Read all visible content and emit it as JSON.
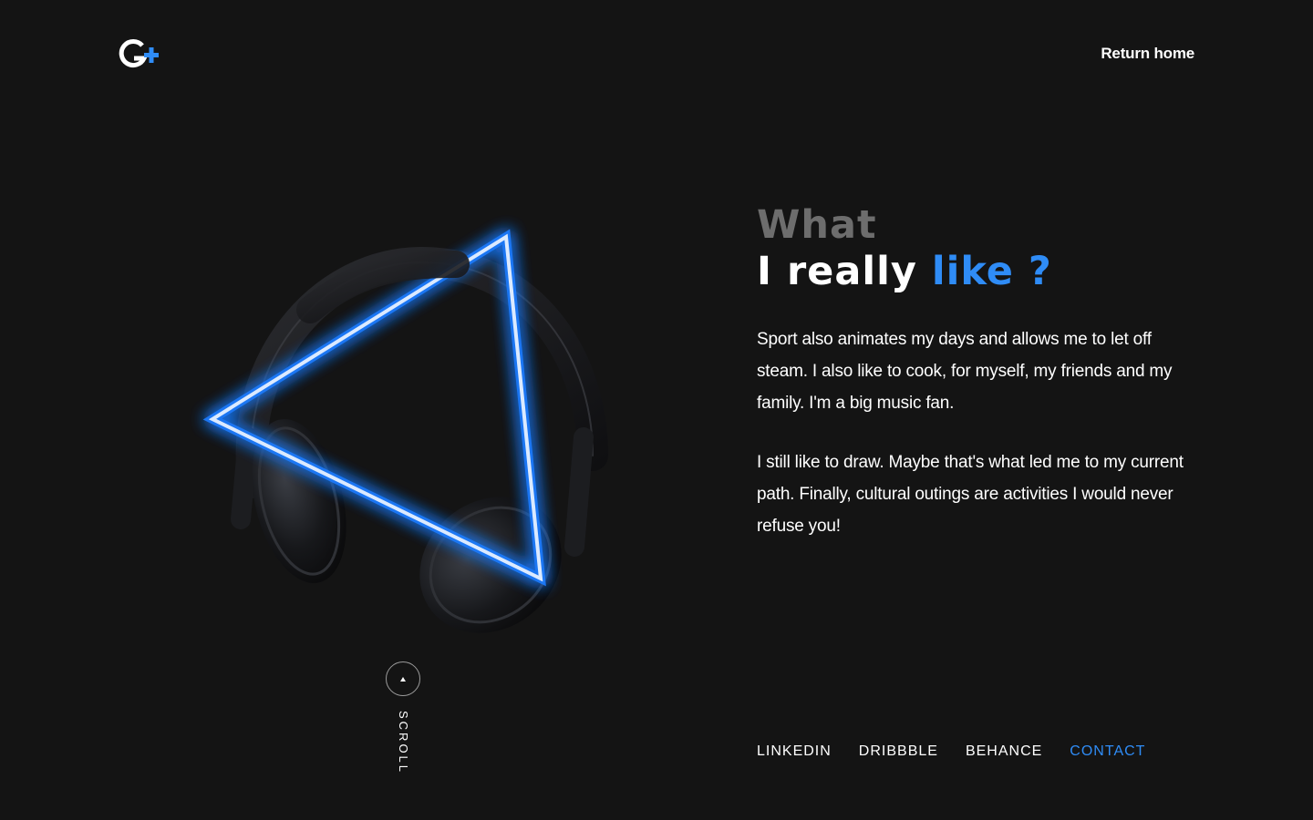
{
  "header": {
    "logo_icon": "g-plus-logo-icon",
    "return_home_label": "Return home"
  },
  "hero": {
    "image_description_icon": "headphones-neon-triangle-image",
    "scroll_label": "SCROLL",
    "scroll_icon": "arrow-up-icon"
  },
  "content": {
    "heading_line1": "What",
    "heading_line2_white": "I really",
    "heading_line2_accent": "like ?",
    "paragraphs": [
      "Sport also animates my days and allows me to let off steam. I also like to cook, for myself, my friends and my family. I'm a big music fan.",
      "I still like to draw. Maybe that's what led me to my current path. Finally, cultural outings are activities I would never refuse you!"
    ]
  },
  "social": {
    "links": [
      "LINKEDIN",
      "DRIBBBLE",
      "BEHANCE",
      "CONTACT"
    ],
    "active": "CONTACT"
  },
  "colors": {
    "background": "#141414",
    "accent": "#2f8cf6",
    "muted_heading": "#6d6d6d",
    "text": "#ffffff"
  }
}
